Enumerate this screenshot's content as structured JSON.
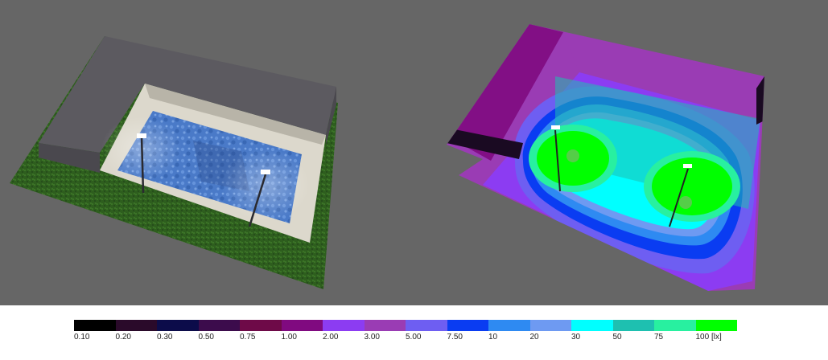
{
  "legend": {
    "bands": [
      {
        "label": "0.10",
        "color": "#000000"
      },
      {
        "label": "0.20",
        "color": "#2a0a2a"
      },
      {
        "label": "0.30",
        "color": "#0c0c4a"
      },
      {
        "label": "0.50",
        "color": "#3c0c4c"
      },
      {
        "label": "0.75",
        "color": "#6e0a48"
      },
      {
        "label": "1.00",
        "color": "#800a80"
      },
      {
        "label": "2.00",
        "color": "#8c3cf2"
      },
      {
        "label": "3.00",
        "color": "#9a3cb4"
      },
      {
        "label": "5.00",
        "color": "#6e5ef2"
      },
      {
        "label": "7.50",
        "color": "#0a3cf2"
      },
      {
        "label": "10",
        "color": "#2e8af2"
      },
      {
        "label": "20",
        "color": "#6e9af2"
      },
      {
        "label": "30",
        "color": "#00ffff"
      },
      {
        "label": "50",
        "color": "#1ec0b0"
      },
      {
        "label": "75",
        "color": "#28f0a0"
      },
      {
        "label": "100 [lx]",
        "color": "#00ff00"
      }
    ]
  },
  "scene": {
    "background_color": "#666666",
    "left_view": {
      "grass_color": "#2e5e1e",
      "building_color": "#5c5a60",
      "deck_color": "#dcd8cc",
      "water_color": "#4a7ac8",
      "lamp_count": 2
    },
    "right_view": {
      "lamp_count": 2
    }
  }
}
